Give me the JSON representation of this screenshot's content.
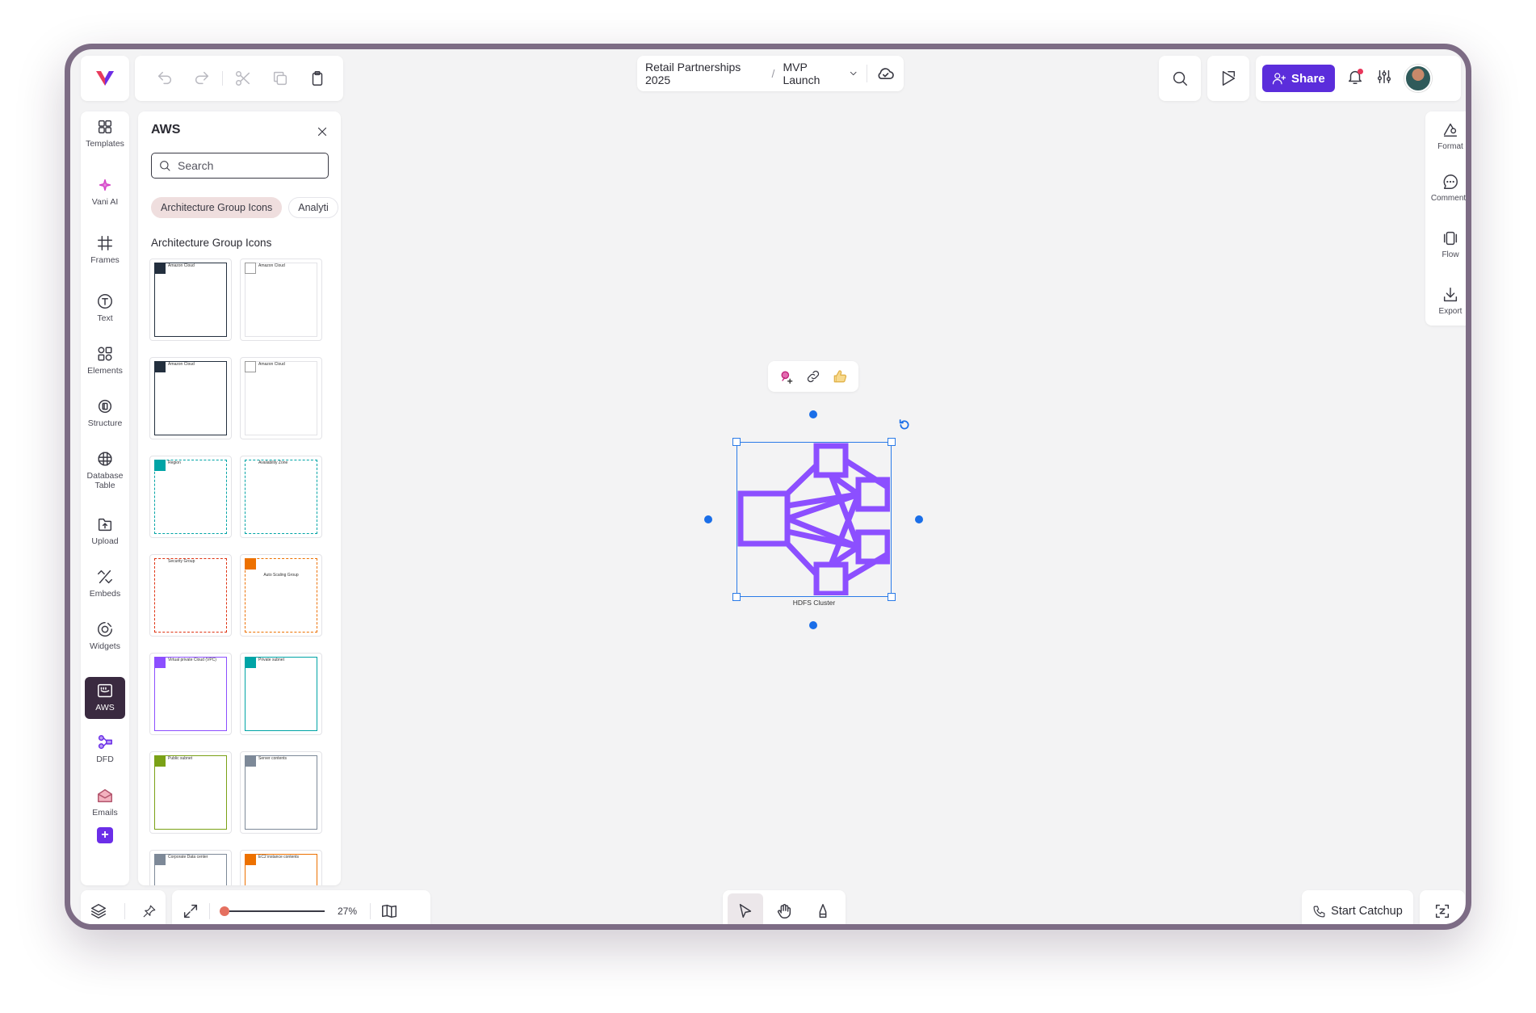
{
  "breadcrumb": {
    "project": "Retail Partnerships 2025",
    "board": "MVP Launch"
  },
  "header": {
    "share_label": "Share"
  },
  "rail": {
    "items": [
      {
        "label": "Templates",
        "icon": "templates-icon"
      },
      {
        "label": "Vani AI",
        "icon": "sparkle-icon"
      },
      {
        "label": "Frames",
        "icon": "frame-icon"
      },
      {
        "label": "Text",
        "icon": "text-icon"
      },
      {
        "label": "Elements",
        "icon": "shapes-icon"
      },
      {
        "label": "Structure",
        "icon": "structure-icon"
      },
      {
        "label": "Database Table",
        "icon": "database-icon"
      },
      {
        "label": "Upload",
        "icon": "upload-icon"
      },
      {
        "label": "Embeds",
        "icon": "embed-icon"
      },
      {
        "label": "Widgets",
        "icon": "widget-icon"
      },
      {
        "label": "AWS",
        "icon": "aws-icon"
      },
      {
        "label": "DFD",
        "icon": "dfd-icon"
      },
      {
        "label": "Emails",
        "icon": "email-icon"
      }
    ]
  },
  "panel": {
    "title": "AWS",
    "search_placeholder": "Search",
    "chips": [
      "Architecture Group Icons",
      "Analyti"
    ],
    "section_title": "Architecture Group Icons",
    "tiles": [
      {
        "label": "Amazon Cloud",
        "border": "#232f3e",
        "badge": "#232f3e"
      },
      {
        "label": "Amazon Cloud",
        "border": "#e3e3e7",
        "badge": "#ffffff"
      },
      {
        "label": "Amazon Cloud",
        "border": "#232f3e",
        "badge": "#232f3e"
      },
      {
        "label": "Amazon Cloud",
        "border": "#e3e3e7",
        "badge": "#ffffff"
      },
      {
        "label": "Region",
        "border": "#00a4a6",
        "badge": "#00a4a6"
      },
      {
        "label": "Availability Zone",
        "border": "#00a4a6",
        "badge": ""
      },
      {
        "label": "Security Group",
        "border": "#df3312",
        "badge": ""
      },
      {
        "label": "Auto Scaling Group",
        "border": "#ed7100",
        "badge": "#ed7100"
      },
      {
        "label": "Virtual private Cloud (VPC)",
        "border": "#8c4fff",
        "badge": "#8c4fff"
      },
      {
        "label": "Private subnet",
        "border": "#00a4a6",
        "badge": "#00a4a6"
      },
      {
        "label": "Public subnet",
        "border": "#7aa116",
        "badge": "#7aa116"
      },
      {
        "label": "Server contents",
        "border": "#7d8998",
        "badge": "#7d8998"
      },
      {
        "label": "Corporate Data center",
        "border": "#7d8998",
        "badge": "#7d8998"
      },
      {
        "label": "EC2 instance contents",
        "border": "#ed7100",
        "badge": "#ed7100"
      }
    ]
  },
  "canvas": {
    "shape_label": "HDFS Cluster",
    "shape_color": "#8c4fff",
    "selection_color": "#2a7be8"
  },
  "right_rail": {
    "items": [
      {
        "label": "Format",
        "icon": "format-icon"
      },
      {
        "label": "Comments",
        "icon": "comment-icon"
      },
      {
        "label": "Flow",
        "icon": "flow-icon"
      },
      {
        "label": "Export",
        "icon": "export-icon"
      }
    ]
  },
  "bottom": {
    "zoom": "27%",
    "zoom_fraction": 0.27,
    "catchup_label": "Start Catchup"
  }
}
